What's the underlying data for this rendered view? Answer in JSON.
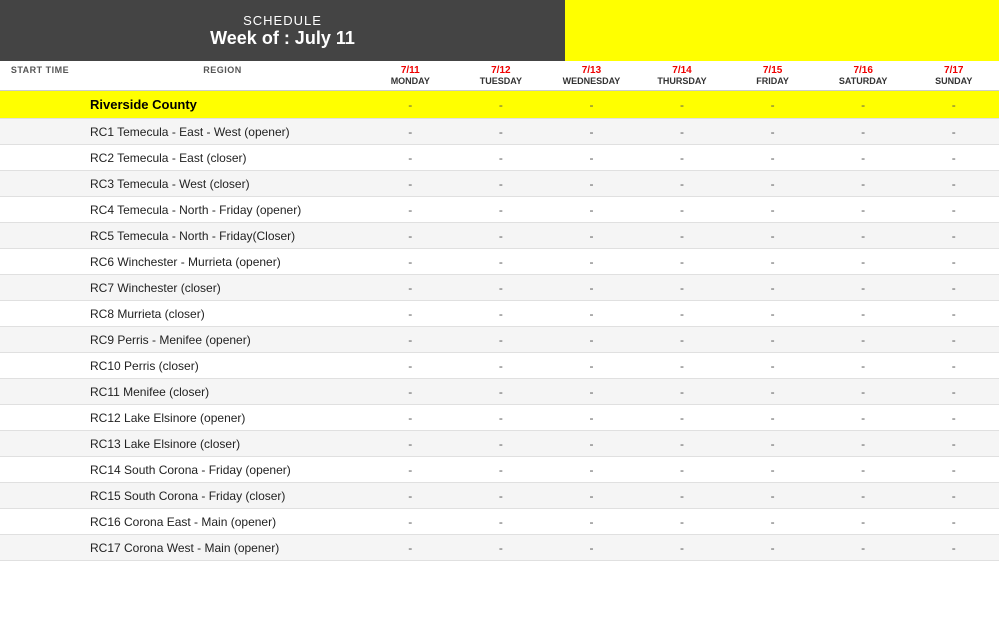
{
  "header": {
    "schedule_label": "SCHEDULE",
    "week_label": "Week of : July 11"
  },
  "columns": {
    "start_time": "START TIME",
    "region": "REGION",
    "days": [
      {
        "date": "7/11",
        "name": "MONDAY"
      },
      {
        "date": "7/12",
        "name": "TUESDAY"
      },
      {
        "date": "7/13",
        "name": "WEDNESDAY"
      },
      {
        "date": "7/14",
        "name": "THURSDAY"
      },
      {
        "date": "7/15",
        "name": "FRIDAY"
      },
      {
        "date": "7/16",
        "name": "SATURDAY"
      },
      {
        "date": "7/17",
        "name": "SUNDAY"
      }
    ]
  },
  "sections": [
    {
      "type": "county",
      "name": "Riverside County"
    },
    {
      "name": "RC1 Temecula - East - West (opener)"
    },
    {
      "name": "RC2 Temecula - East (closer)"
    },
    {
      "name": "RC3 Temecula - West (closer)"
    },
    {
      "name": "RC4 Temecula - North - Friday (opener)"
    },
    {
      "name": "RC5 Temecula - North - Friday(Closer)"
    },
    {
      "name": "RC6 Winchester - Murrieta (opener)"
    },
    {
      "name": "RC7 Winchester (closer)"
    },
    {
      "name": "RC8 Murrieta (closer)"
    },
    {
      "name": "RC9 Perris - Menifee (opener)"
    },
    {
      "name": "RC10 Perris (closer)"
    },
    {
      "name": "RC11 Menifee (closer)"
    },
    {
      "name": "RC12 Lake Elsinore (opener)"
    },
    {
      "name": "RC13 Lake Elsinore (closer)"
    },
    {
      "name": "RC14 South Corona - Friday (opener)"
    },
    {
      "name": "RC15 South Corona - Friday (closer)"
    },
    {
      "name": "RC16 Corona East - Main (opener)"
    },
    {
      "name": "RC17 Corona West - Main (opener)"
    }
  ],
  "dash": "-"
}
